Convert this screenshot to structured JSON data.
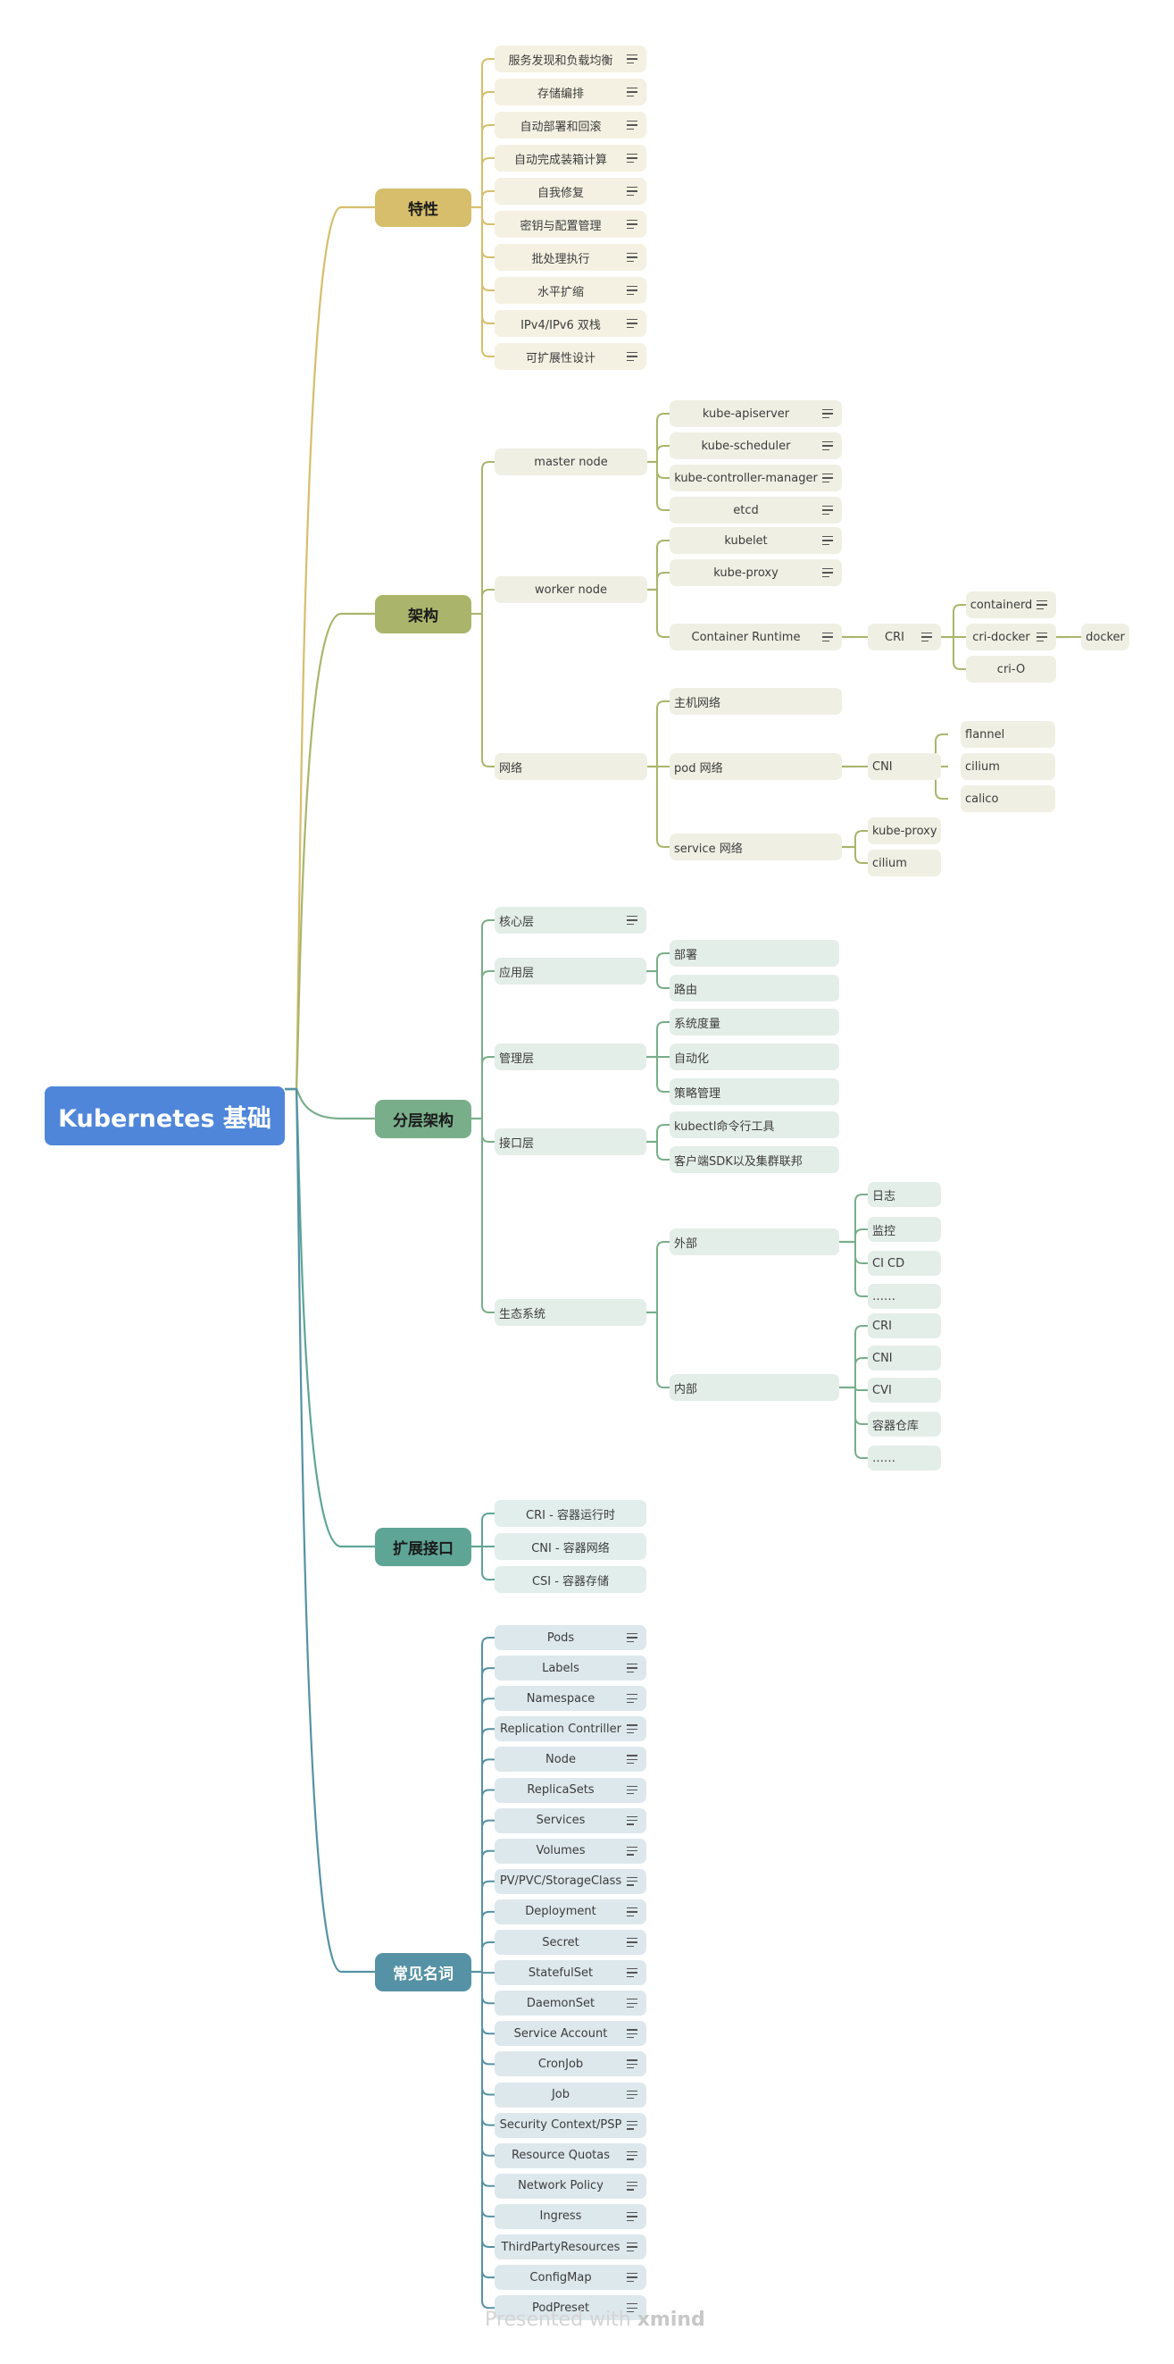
{
  "title": "Kubernetes 基础",
  "watermark": {
    "prefix": "Presented with",
    "brand": "xmind"
  },
  "colors": {
    "root": "#4f86d9",
    "features": "#d6be6c",
    "architecture": "#aab56b",
    "layered": "#79ae8a",
    "extension": "#5ea596",
    "terms": "#5592a5"
  },
  "branches": [
    {
      "label": "特性",
      "children": [
        {
          "label": "服务发现和负载均衡",
          "note": true
        },
        {
          "label": "存储编排",
          "note": true
        },
        {
          "label": "自动部署和回滚",
          "note": true
        },
        {
          "label": "自动完成装箱计算",
          "note": true
        },
        {
          "label": "自我修复",
          "note": true
        },
        {
          "label": "密钥与配置管理",
          "note": true
        },
        {
          "label": "批处理执行",
          "note": true
        },
        {
          "label": "水平扩缩",
          "note": true
        },
        {
          "label": "IPv4/IPv6 双栈",
          "note": true
        },
        {
          "label": "可扩展性设计",
          "note": true
        }
      ]
    },
    {
      "label": "架构",
      "children": [
        {
          "label": "master node",
          "children": [
            {
              "label": "kube-apiserver",
              "note": true
            },
            {
              "label": "kube-scheduler",
              "note": true
            },
            {
              "label": "kube-controller-manager",
              "note": true
            },
            {
              "label": "etcd",
              "note": true
            }
          ]
        },
        {
          "label": "worker node",
          "children": [
            {
              "label": "kubelet",
              "note": true
            },
            {
              "label": "kube-proxy",
              "note": true
            },
            {
              "label": "Container Runtime",
              "note": true,
              "children": [
                {
                  "label": "CRI",
                  "note": true,
                  "children": [
                    {
                      "label": "containerd",
                      "note": true
                    },
                    {
                      "label": "cri-docker",
                      "note": true,
                      "children": [
                        {
                          "label": "docker"
                        }
                      ]
                    },
                    {
                      "label": "cri-O"
                    }
                  ]
                }
              ]
            }
          ]
        },
        {
          "label": "网络",
          "children": [
            {
              "label": "主机网络"
            },
            {
              "label": "pod 网络",
              "children": [
                {
                  "label": "CNI",
                  "children": [
                    {
                      "label": "flannel"
                    },
                    {
                      "label": "cilium"
                    },
                    {
                      "label": "calico"
                    }
                  ]
                }
              ]
            },
            {
              "label": "service 网络",
              "children": [
                {
                  "label": "kube-proxy"
                },
                {
                  "label": "cilium"
                }
              ]
            }
          ]
        }
      ]
    },
    {
      "label": "分层架构",
      "children": [
        {
          "label": "核心层",
          "note": true
        },
        {
          "label": "应用层",
          "children": [
            {
              "label": "部署"
            },
            {
              "label": "路由"
            }
          ]
        },
        {
          "label": "管理层",
          "children": [
            {
              "label": "系统度量"
            },
            {
              "label": "自动化"
            },
            {
              "label": "策略管理"
            }
          ]
        },
        {
          "label": "接口层",
          "children": [
            {
              "label": "kubectl命令行工具"
            },
            {
              "label": "客户端SDK以及集群联邦"
            }
          ]
        },
        {
          "label": "生态系统",
          "children": [
            {
              "label": "外部",
              "children": [
                {
                  "label": "日志"
                },
                {
                  "label": "监控"
                },
                {
                  "label": "CI CD"
                },
                {
                  "label": "……"
                }
              ]
            },
            {
              "label": "内部",
              "children": [
                {
                  "label": "CRI"
                },
                {
                  "label": "CNI"
                },
                {
                  "label": "CVI"
                },
                {
                  "label": "容器仓库"
                },
                {
                  "label": "……"
                }
              ]
            }
          ]
        }
      ]
    },
    {
      "label": "扩展接口",
      "children": [
        {
          "label": "CRI - 容器运行时"
        },
        {
          "label": "CNI - 容器网络"
        },
        {
          "label": "CSI - 容器存储"
        }
      ]
    },
    {
      "label": "常见名词",
      "children": [
        {
          "label": "Pods",
          "note": true
        },
        {
          "label": "Labels",
          "note": true
        },
        {
          "label": "Namespace",
          "note": true
        },
        {
          "label": "Replication Contriller",
          "note": true
        },
        {
          "label": "Node",
          "note": true
        },
        {
          "label": "ReplicaSets",
          "note": true
        },
        {
          "label": "Services",
          "note": true
        },
        {
          "label": "Volumes",
          "note": true
        },
        {
          "label": "PV/PVC/StorageClass",
          "note": true
        },
        {
          "label": "Deployment",
          "note": true
        },
        {
          "label": "Secret",
          "note": true
        },
        {
          "label": "StatefulSet",
          "note": true
        },
        {
          "label": "DaemonSet",
          "note": true
        },
        {
          "label": "Service Account",
          "note": true
        },
        {
          "label": "CronJob",
          "note": true
        },
        {
          "label": "Job",
          "note": true
        },
        {
          "label": "Security Context/PSP",
          "note": true
        },
        {
          "label": "Resource Quotas",
          "note": true
        },
        {
          "label": "Network Policy",
          "note": true
        },
        {
          "label": "Ingress",
          "note": true
        },
        {
          "label": "ThirdPartyResources",
          "note": true
        },
        {
          "label": "ConfigMap",
          "note": true
        },
        {
          "label": "PodPreset",
          "note": true
        }
      ]
    }
  ]
}
